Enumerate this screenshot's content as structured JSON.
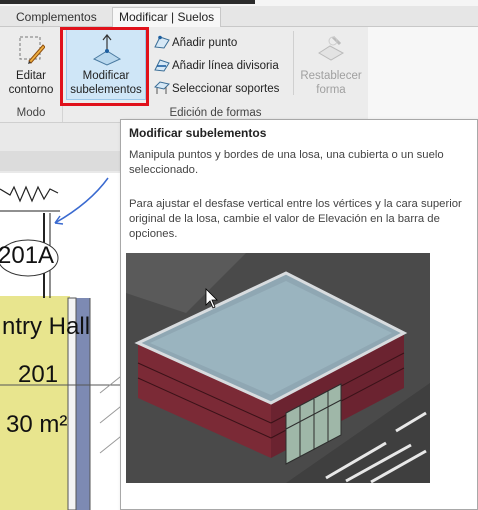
{
  "tabs": [
    {
      "label": "Complementos"
    },
    {
      "label": "Modificar | Suelos"
    }
  ],
  "ribbon": {
    "mode_panel_label": "Modo",
    "edit_panel_label": "Edición de formas",
    "editar_contorno": "Editar\ncontorno",
    "modificar_subelementos": "Modificar\nsubelementos",
    "anadir_punto": "Añadir punto",
    "anadir_linea": "Añadir línea divisoria",
    "seleccionar_soportes": "Seleccionar soportes",
    "restablecer_forma": "Restablecer\nforma"
  },
  "drawing": {
    "tag_201a": "201A",
    "room_name": "ntry Hall",
    "room_number": "201",
    "room_area": "30 m²"
  },
  "tooltip": {
    "title": "Modificar subelementos",
    "description": "Manipula puntos y bordes de una losa, una cubierta o un suelo seleccionado.",
    "note": "Para ajustar el desfase vertical entre los vértices y la cara superior original de la losa, cambie el valor de Elevación en la barra de opciones."
  },
  "colors": {
    "highlight_border": "#e0111b",
    "active_button": "#cfe6f7",
    "room_fill": "#e8e58e"
  }
}
